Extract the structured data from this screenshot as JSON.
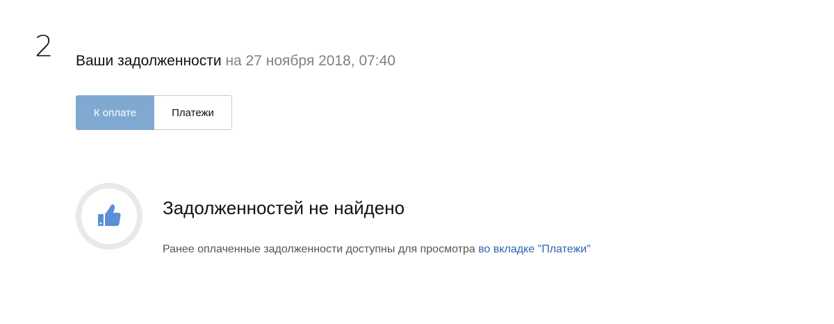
{
  "step": {
    "number": "2"
  },
  "header": {
    "title": "Ваши задолженности",
    "date_text": "на 27 ноября 2018, 07:40"
  },
  "tabs": [
    {
      "label": "К оплате",
      "active": true
    },
    {
      "label": "Платежи",
      "active": false
    }
  ],
  "empty_state": {
    "icon": "thumbs-up-icon",
    "title": "Задолженностей не найдено",
    "description": "Ранее оплаченные задолженности доступны для просмотра ",
    "link_text": "во вкладке \"Платежи\""
  },
  "colors": {
    "active_tab": "#7fa9d1",
    "link": "#2b66b0",
    "icon": "#5b8fd6",
    "circle_ring": "#e7eaed"
  }
}
